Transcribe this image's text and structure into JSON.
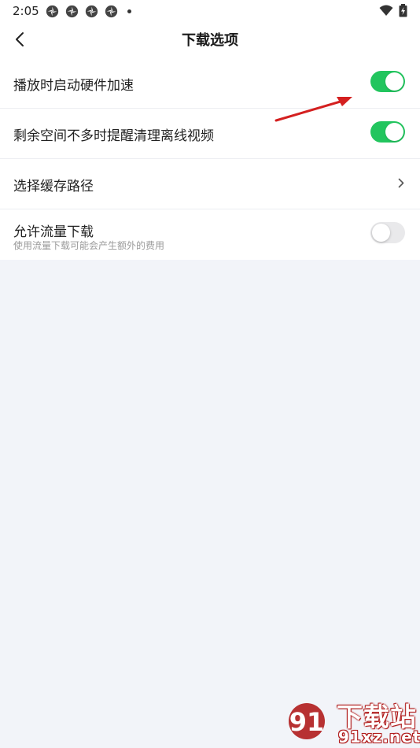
{
  "status_bar": {
    "time": "2:05",
    "notification_icons": [
      "app-notification-icon",
      "app-notification-icon",
      "app-notification-icon",
      "app-notification-icon"
    ],
    "wifi_icon": "wifi-icon",
    "battery_icon": "battery-charging-icon"
  },
  "header": {
    "back_icon": "chevron-left-icon",
    "title": "下载选项"
  },
  "settings": [
    {
      "label": "播放时启动硬件加速",
      "control": "toggle",
      "on": true
    },
    {
      "label": "剩余空间不多时提醒清理离线视频",
      "control": "toggle",
      "on": true
    },
    {
      "label": "选择缓存路径",
      "control": "chevron",
      "icon": "chevron-right-icon"
    },
    {
      "label": "允许流量下载",
      "sublabel": "使用流量下载可能会产生额外的费用",
      "control": "toggle",
      "on": false
    }
  ],
  "colors": {
    "toggle_on": "#22c55e",
    "toggle_off": "#e9e9eb",
    "page_background": "#f2f4f9",
    "annotation_arrow": "#d42020",
    "watermark": "#b01c1c"
  },
  "annotation": {
    "icon": "red-arrow"
  },
  "watermark": {
    "title": "下载站",
    "site": "91xz.net",
    "mark_text": "91"
  }
}
